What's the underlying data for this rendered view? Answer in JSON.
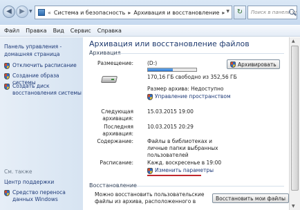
{
  "address_bar": {
    "breadcrumb": [
      "Система и безопасность",
      "Архивация и восстановление"
    ],
    "search_placeholder": "Поиск в панели управления"
  },
  "menu": [
    "Файл",
    "Правка",
    "Вид",
    "Сервис",
    "Справка"
  ],
  "left_pane": {
    "home": "Панель управления - домашняя страница",
    "items": [
      "Отключить расписание",
      "Создание образа системы",
      "Создать диск восстановления системы"
    ],
    "see_also": "См. также",
    "links": [
      "Центр поддержки",
      "Средство переноса данных Windows"
    ]
  },
  "main": {
    "title": "Архивация или восстановление файлов",
    "backup_section": "Архивация",
    "location_label": "Размещение:",
    "location_value": "(D:)",
    "usage_fraction": 0.52,
    "free_space": "170,16 ГБ свободно из 352,56 ГБ",
    "archive_size": "Размер архива: Недоступно",
    "manage_space": "Управление пространством",
    "backup_button": "Архивировать",
    "next_label": "Следующая архивация:",
    "next_value": "15.03.2015 19:00",
    "last_label": "Последняя архивация:",
    "last_value": "10.03.2015 20:29",
    "content_label": "Содержание:",
    "content_value": "Файлы в библиотеках и личные папки выбранных пользователей",
    "schedule_label": "Расписание:",
    "schedule_value": "Кажд. воскресенье в 19:00",
    "change_settings": "Изменить параметры",
    "restore_section": "Восстановление",
    "restore_text": "Можно восстановить пользовательские файлы из архива, расположенного в",
    "restore_button": "Восстановить мои файлы"
  },
  "colors": {
    "link": "#1e3a78",
    "title": "#1e3a6e",
    "underline_annotation": "#c0272d"
  }
}
